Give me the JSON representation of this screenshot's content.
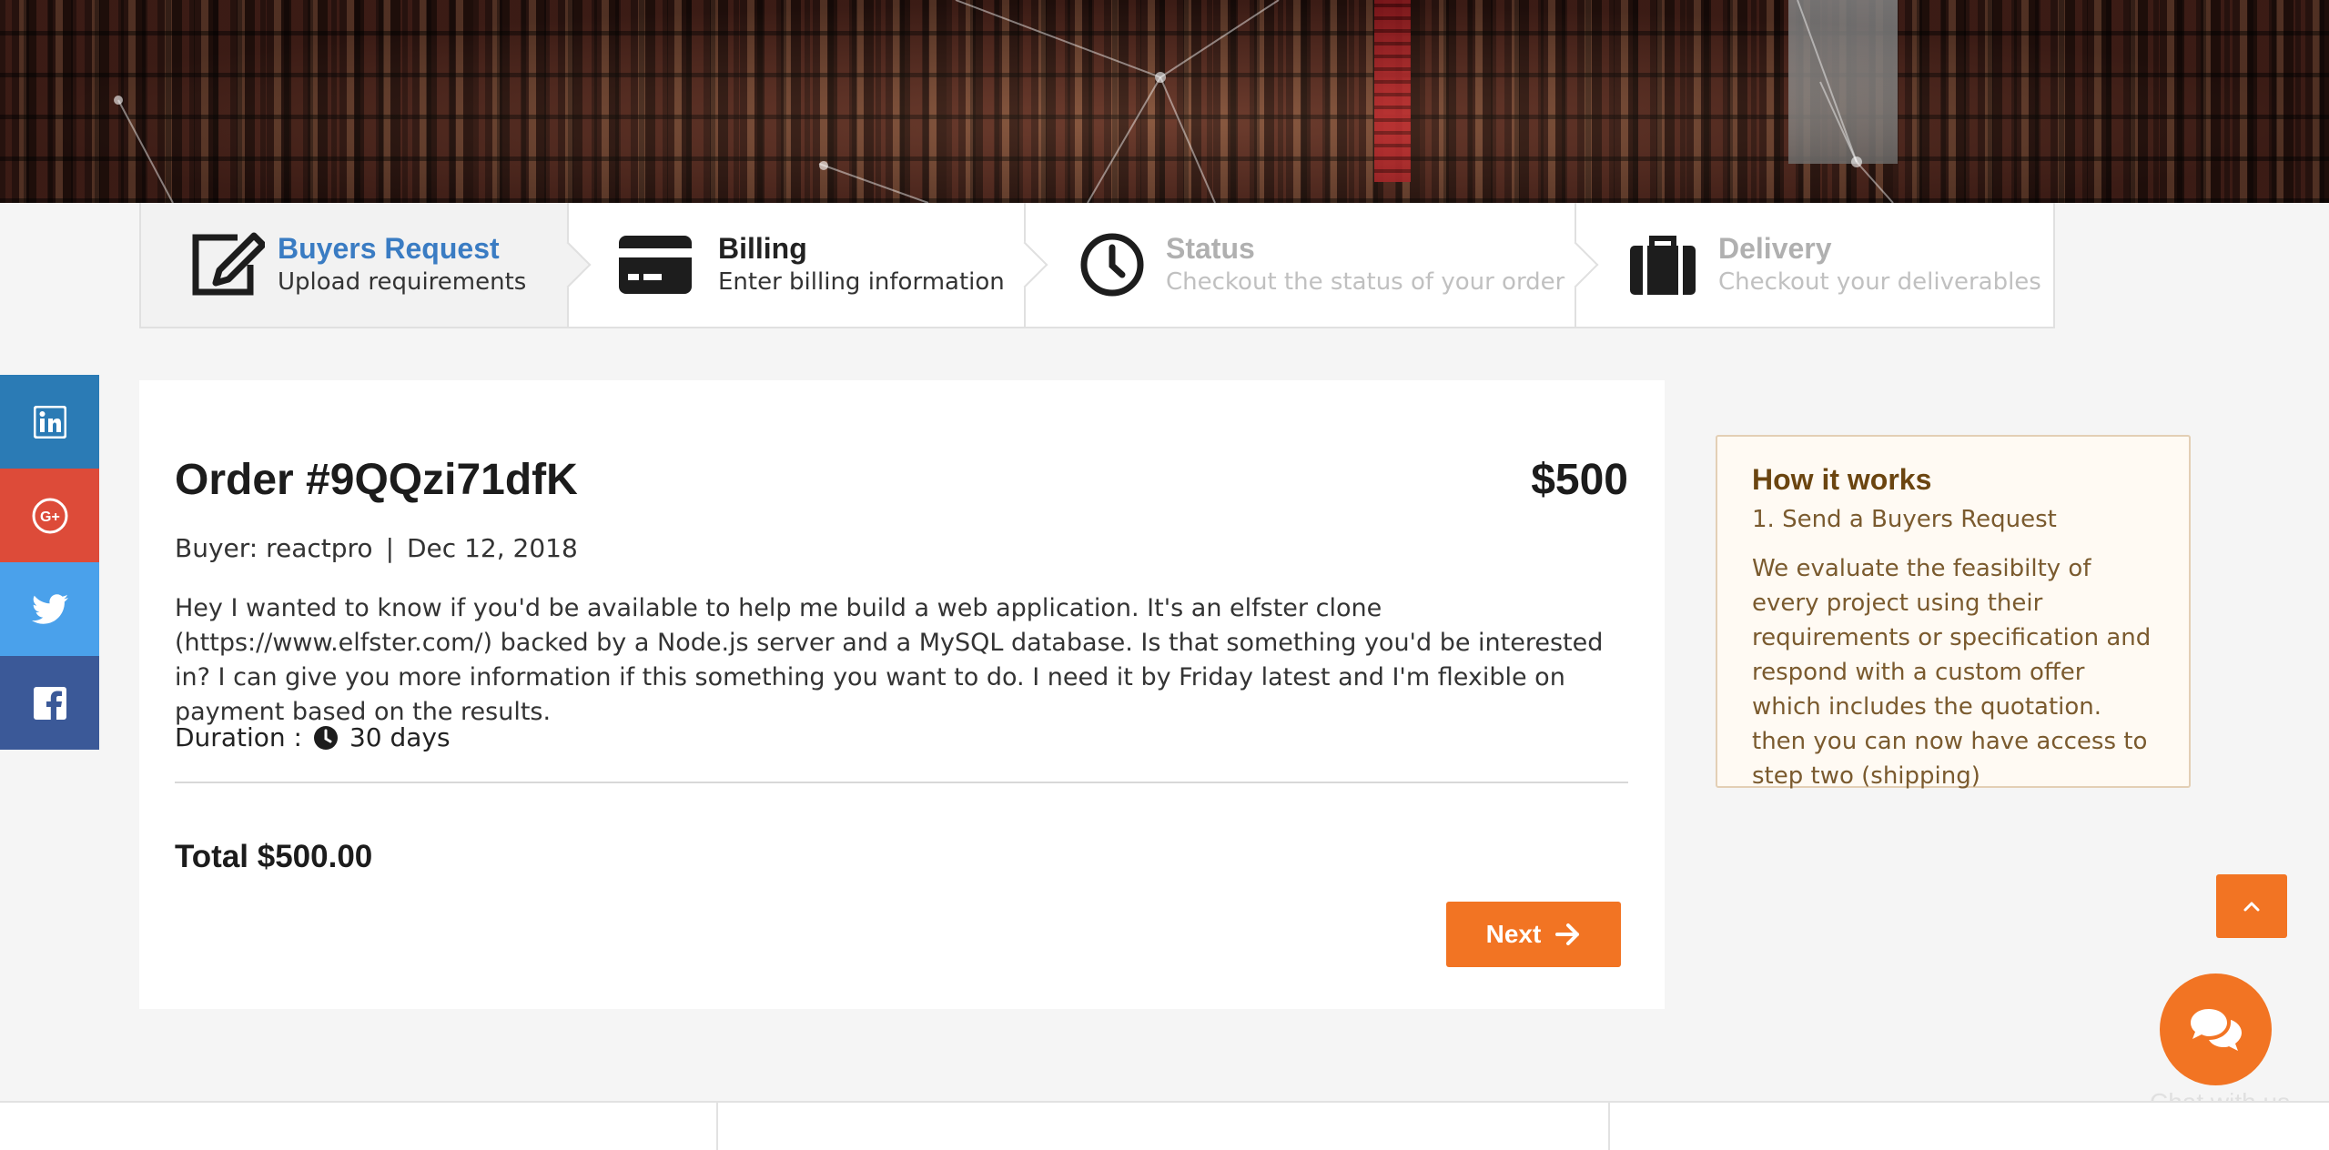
{
  "stepper": {
    "steps": [
      {
        "title": "Buyers Request",
        "subtitle": "Upload requirements",
        "icon": "edit-icon",
        "state": "active"
      },
      {
        "title": "Billing",
        "subtitle": "Enter billing information",
        "icon": "credit-card-icon",
        "state": "current"
      },
      {
        "title": "Status",
        "subtitle": "Checkout the status of your order",
        "icon": "clock-icon",
        "state": "muted"
      },
      {
        "title": "Delivery",
        "subtitle": "Checkout your deliverables",
        "icon": "briefcase-icon",
        "state": "muted"
      }
    ]
  },
  "social": [
    {
      "icon": "linkedin-icon",
      "color": "#2b7bb5"
    },
    {
      "icon": "google-plus-icon",
      "color": "#dd4b39"
    },
    {
      "icon": "twitter-icon",
      "color": "#4aa1eb"
    },
    {
      "icon": "facebook-icon",
      "color": "#3b5998"
    }
  ],
  "order": {
    "title": "Order #9QQzi71dfK",
    "price": "$500",
    "buyer": "Buyer: reactpro",
    "separator": "|",
    "date": "Dec 12, 2018",
    "description": "Hey I wanted to know if you'd be available to help me build a web application. It's an elfster clone (https://www.elfster.com/) backed by a Node.js server and a MySQL database. Is that something you'd be interested in? I can give you more information if this something you want to do. I need it by Friday latest and I'm flexible on payment based on the results.",
    "duration_label": "Duration :",
    "duration_value": "30 days",
    "total": "Total $500.00",
    "next_label": "Next"
  },
  "how_it_works": {
    "title": "How it works",
    "step": "1. Send a Buyers Request",
    "text": "We evaluate the feasibilty of every project using their requirements or specification and respond with a custom offer which includes the quotation. then you can now have access to step two (shipping)"
  },
  "chat": {
    "label": "Chat with us"
  },
  "colors": {
    "accent": "#f27423",
    "active_step": "#3a7cc3",
    "how_title": "#6b4510"
  }
}
